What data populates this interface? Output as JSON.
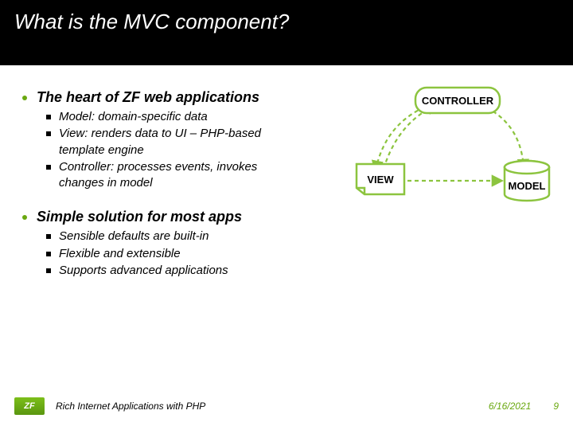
{
  "title": "What is the MVC component?",
  "section1": {
    "heading": "The heart of ZF web applications",
    "items": [
      "Model: domain-specific data",
      "View: renders data to UI – PHP-based template engine",
      "Controller: processes events, invokes changes in model"
    ]
  },
  "section2": {
    "heading": "Simple solution for most apps",
    "items": [
      "Sensible defaults are built-in",
      "Flexible and extensible",
      "Supports advanced applications"
    ]
  },
  "diagram": {
    "controller": "CONTROLLER",
    "view": "VIEW",
    "model": "MODEL"
  },
  "footer": {
    "logo": "ZF",
    "text": "Rich Internet Applications with PHP",
    "date": "6/16/2021",
    "page": "9"
  }
}
